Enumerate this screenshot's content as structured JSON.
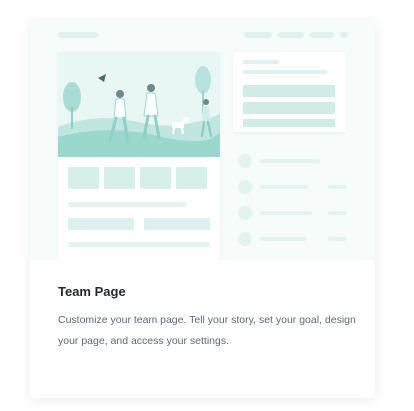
{
  "card": {
    "title": "Team Page",
    "description": "Customize your team page. Tell your story, set your goal, design your page, and access your settings."
  },
  "colors": {
    "accent": "#7fd3c6",
    "accent_light": "#dcf1ed",
    "title_text": "#1f2a30",
    "body_text": "#5f6b72"
  },
  "illustration": {
    "semantic": "team-page-preview-illustration"
  }
}
